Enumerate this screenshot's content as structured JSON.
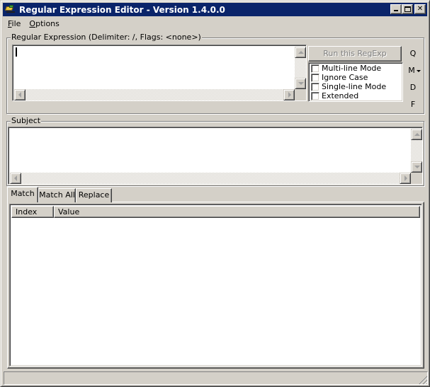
{
  "window": {
    "title": "Regular Expression Editor - Version 1.4.0.0",
    "controls": [
      "minimize",
      "maximize",
      "close"
    ]
  },
  "menu": [
    {
      "label": "File",
      "mnemonic": "F",
      "rest": "ile"
    },
    {
      "label": "Options",
      "mnemonic": "O",
      "rest": "ptions"
    }
  ],
  "regex": {
    "group_label": "Regular Expression (Delimiter: /, Flags: <none>)",
    "value": "",
    "run_button": "Run this RegExp",
    "flags": [
      {
        "label": "Multi-line Mode",
        "checked": false
      },
      {
        "label": "Ignore Case",
        "checked": false
      },
      {
        "label": "Single-line Mode",
        "checked": false
      },
      {
        "label": "Extended",
        "checked": false
      }
    ],
    "side_buttons": [
      "Q",
      "M",
      "D",
      "F"
    ]
  },
  "subject": {
    "group_label": "Subject",
    "value": ""
  },
  "tabs": [
    {
      "label": "Match",
      "active": true
    },
    {
      "label": "Match All",
      "active": false
    },
    {
      "label": "Replace",
      "active": false
    }
  ],
  "results": {
    "columns": [
      "Index",
      "Value"
    ],
    "rows": []
  },
  "status": ""
}
